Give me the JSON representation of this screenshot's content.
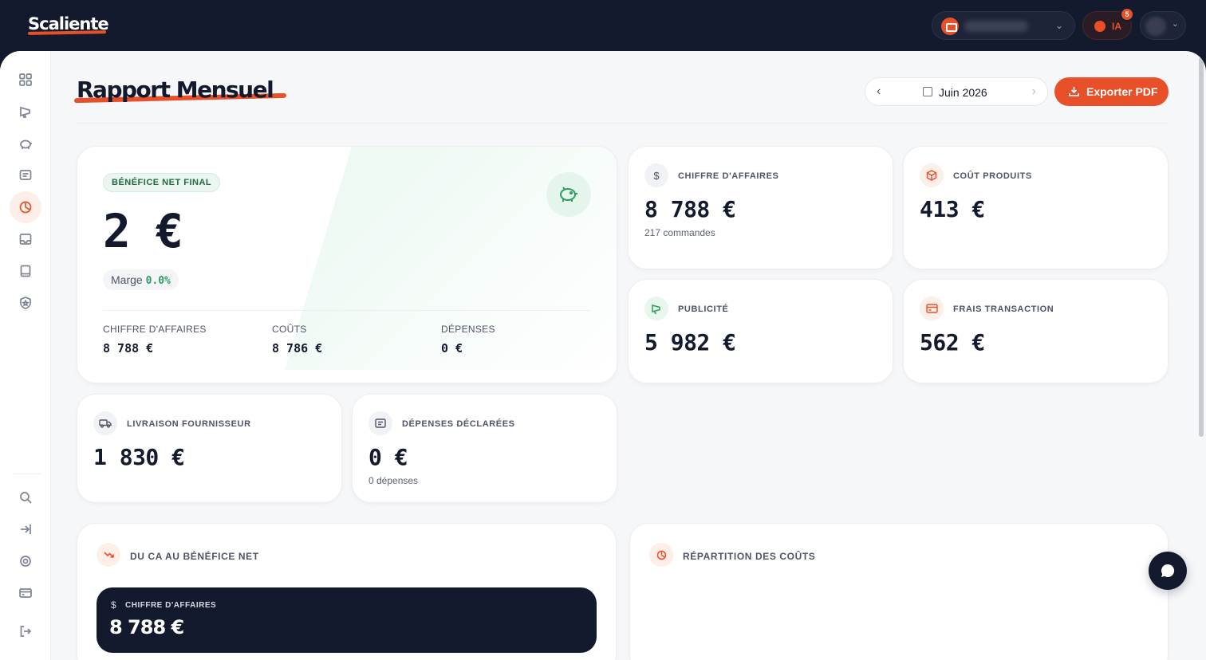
{
  "app": {
    "logo": "Scaliente"
  },
  "topbar": {
    "ia_label": "IA",
    "ia_badge_count": "5",
    "store_chevron_icon": "chevron-down-icon"
  },
  "sidebar": {
    "items": [
      {
        "icon": "grid-icon"
      },
      {
        "icon": "megaphone-icon"
      },
      {
        "icon": "piggy-bank-icon"
      },
      {
        "icon": "receipt-icon"
      },
      {
        "icon": "pie-chart-icon",
        "active": true
      },
      {
        "icon": "inbox-icon"
      },
      {
        "icon": "book-icon"
      },
      {
        "icon": "shield-star-icon"
      }
    ],
    "bottom": [
      {
        "icon": "search-icon"
      },
      {
        "icon": "collapse-icon"
      },
      {
        "icon": "gear-icon"
      },
      {
        "icon": "credit-card-icon"
      },
      {
        "icon": "logout-icon"
      }
    ]
  },
  "header": {
    "title": "Rapport Mensuel",
    "month": "Juin 2026",
    "export_label": "Exporter PDF"
  },
  "hero": {
    "pill": "BÉNÉFICE NET FINAL",
    "value": "2 €",
    "marge_label": "Marge",
    "marge_value": "0.0%",
    "columns": [
      {
        "label": "CHIFFRE D'AFFAIRES",
        "value": "8 788 €"
      },
      {
        "label": "COÛTS",
        "value": "8 786 €"
      },
      {
        "label": "DÉPENSES",
        "value": "0 €"
      }
    ]
  },
  "metrics": {
    "ca": {
      "label": "CHIFFRE D'AFFAIRES",
      "value": "8 788 €",
      "sub": "217 commandes"
    },
    "cout_produits": {
      "label": "COÛT PRODUITS",
      "value": "413 €"
    },
    "publicite": {
      "label": "PUBLICITÉ",
      "value": "5 982 €"
    },
    "frais": {
      "label": "FRAIS TRANSACTION",
      "value": "562 €"
    },
    "livraison": {
      "label": "LIVRAISON FOURNISSEUR",
      "value": "1 830 €"
    },
    "depenses": {
      "label": "DÉPENSES DÉCLARÉES",
      "value": "0 €",
      "sub": "0 dépenses"
    }
  },
  "flow": {
    "title": "DU CA AU BÉNÉFICE NET",
    "first_step_label": "CHIFFRE D'AFFAIRES",
    "first_step_value": "8 788 €"
  },
  "repartition": {
    "title": "RÉPARTITION DES COÛTS"
  },
  "colors": {
    "accent": "#e8502a",
    "dark": "#141a2e",
    "success": "#2e9c62"
  }
}
